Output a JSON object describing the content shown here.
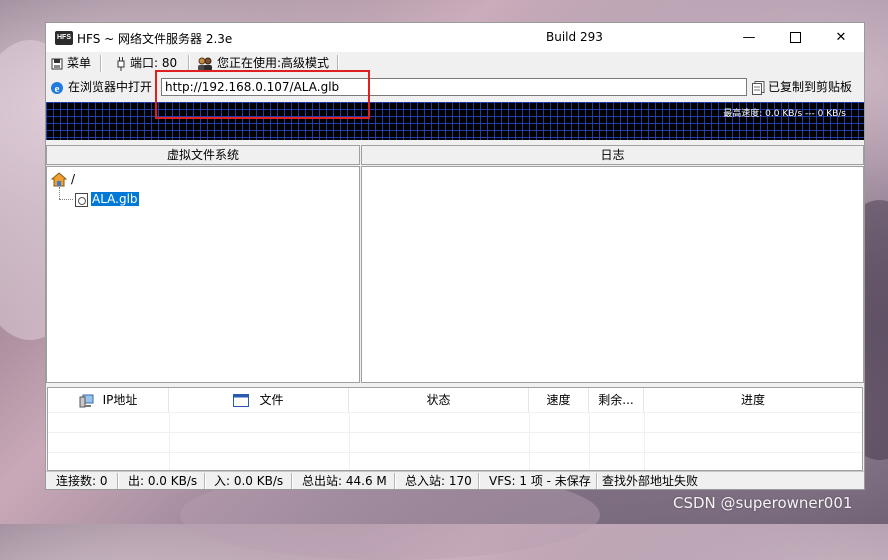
{
  "window": {
    "title": "HFS ~ 网络文件服务器 2.3e",
    "build": "Build 293",
    "logo_text": "HFS",
    "minimize_glyph": "—",
    "close_glyph": "✕"
  },
  "toolbar": {
    "menu_label": "菜单",
    "port_label": "端口: 80",
    "mode_label": "您正在使用:高级模式"
  },
  "urlbar": {
    "open_browser_label": "在浏览器中打开",
    "url_value": "http://192.168.0.107/ALA.glb",
    "copied_label": "已复制到剪贴板"
  },
  "graph": {
    "speed_text": "最高速度: 0.0 KB/s --- 0 KB/s"
  },
  "vfs": {
    "header": "虚拟文件系统",
    "root_label": "/",
    "items": [
      {
        "label": "ALA.glb"
      }
    ]
  },
  "log": {
    "header": "日志"
  },
  "connections": {
    "columns": [
      "IP地址",
      "文件",
      "状态",
      "速度",
      "剩余...",
      "进度"
    ]
  },
  "status": {
    "connections": "连接数: 0",
    "out_speed": "出: 0.0 KB/s",
    "in_speed": "入: 0.0 KB/s",
    "total_out": "总出站: 44.6 M",
    "total_in": "总入站: 170",
    "vfs_info": "VFS: 1 项 - 未保存",
    "external_ip": "查找外部地址失败"
  },
  "watermark": "CSDN @superowner001",
  "colors": {
    "selection": "#0078d7",
    "highlight_box": "#e02020",
    "graph_grid": "#2846c8",
    "graph_bg": "#000000"
  },
  "icons": {
    "menu": "floppy-disk-icon",
    "port": "plug-icon",
    "mode": "users-icon",
    "browser": "ie-icon",
    "clipboard": "clipboard-icon",
    "vfs_root": "home-icon",
    "file": "file-icon",
    "ip": "computer-icon",
    "file_col": "window-icon"
  }
}
